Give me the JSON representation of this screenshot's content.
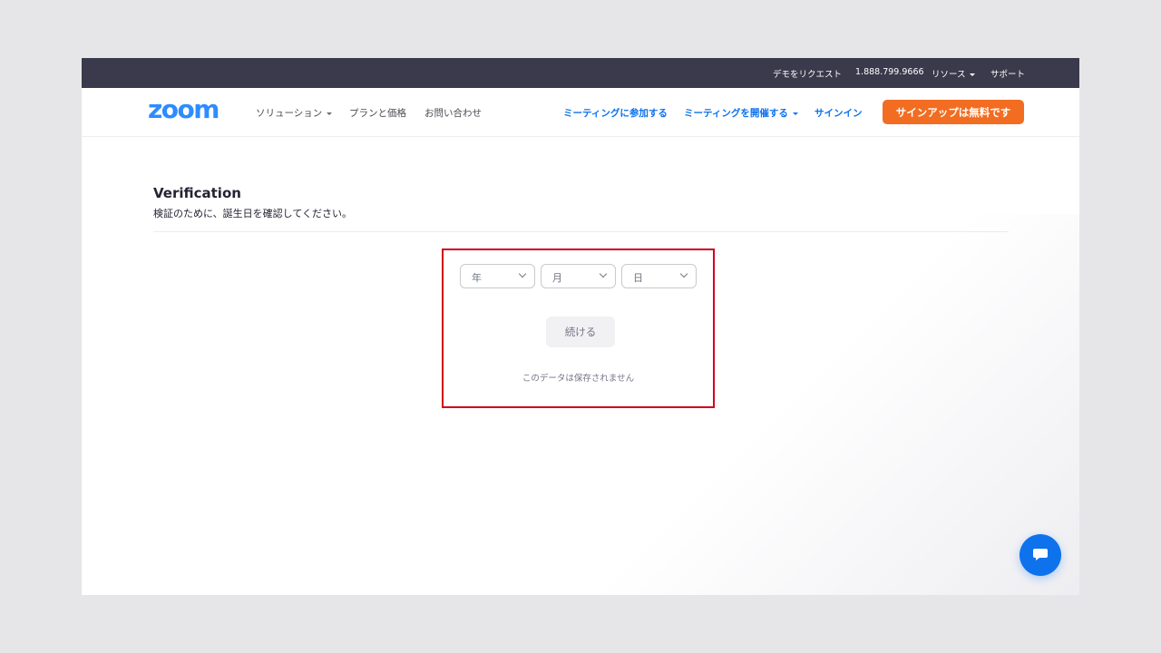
{
  "topbar": {
    "request_demo": "デモをリクエスト",
    "phone": "1.888.799.9666",
    "resources": "リソース",
    "support": "サポート"
  },
  "nav": {
    "logo_text": "zoom",
    "solutions": "ソリューション",
    "plans": "プランと価格",
    "contact": "お問い合わせ",
    "join_meeting": "ミーティングに参加する",
    "host_meeting": "ミーティングを開催する",
    "sign_in": "サインイン",
    "sign_up": "サインアップは無料です"
  },
  "main": {
    "title": "Verification",
    "subtitle": "検証のために、誕生日を確認してください。",
    "year_placeholder": "年",
    "month_placeholder": "月",
    "day_placeholder": "日",
    "continue_label": "続ける",
    "note": "このデータは保存されません"
  },
  "colors": {
    "brand_blue": "#0e72ed",
    "signup_orange": "#f26d21",
    "topbar_bg": "#3a3a4c",
    "highlight_red": "#d0021b"
  },
  "icons": {
    "chat": "chat-bubble-icon",
    "caret": "caret-down-icon",
    "chevron": "chevron-down-icon"
  }
}
